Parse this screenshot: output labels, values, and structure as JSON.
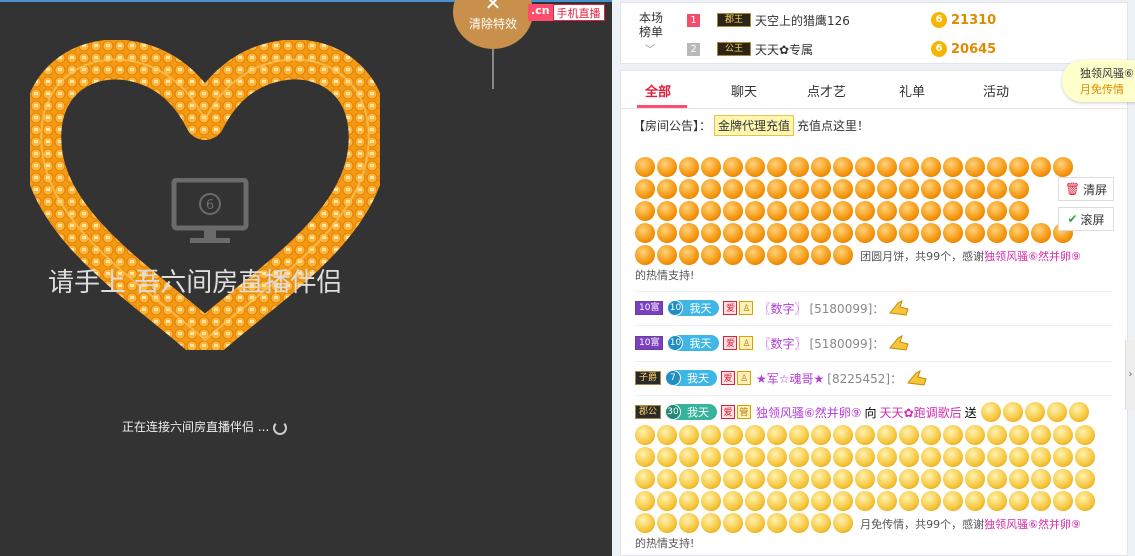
{
  "video": {
    "offline_text": "请手上  吾六间房直播伴侣",
    "loading_text": "正在连接六间房直播伴侣 ...",
    "clear_effects_label": "清除特效",
    "clear_icon": "close-icon",
    "mobile_badge_cn": ".cn",
    "mobile_badge_label": "手机直播",
    "monitor_icon": "monitor-icon",
    "monitor_glyph": "6"
  },
  "ranking": {
    "title": "本场\n榜单",
    "title_line1": "本场",
    "title_line2": "榜单",
    "chevron": "﹀",
    "rows": [
      {
        "rank": "1",
        "badge": "郡王",
        "name": "天空上的猎鹰126",
        "score": "21310",
        "color": "#f24d6a"
      },
      {
        "rank": "2",
        "badge": "公王",
        "name": "天天✿专属",
        "score": "20645",
        "color": "#b9b9b9"
      }
    ],
    "coin_glyph": "6"
  },
  "float": {
    "line1": "独领风骚⑥",
    "line2": "月免传情"
  },
  "tabs": {
    "items": [
      "全部",
      "聊天",
      "点才艺",
      "礼单",
      "活动"
    ],
    "active": "全部"
  },
  "notice": {
    "prefix": "【房间公告】：",
    "gold_label": "金牌代理充值",
    "suffix": "充值点这里！"
  },
  "gift1": {
    "caption_a": "团圆月饼，共99个，感谢",
    "caption_user": "独领风骚⑥然并卵⑨",
    "caption_b": "的热情支持!"
  },
  "side_buttons": {
    "clear_label": "清屏",
    "scroll_label": "滚屏"
  },
  "messages": [
    {
      "level": "10富",
      "fan_lv": "10",
      "fan_name": "我天",
      "s1": "爱",
      "s2": "♙",
      "user": "〖数字〗",
      "uid": "[5180099]："
    },
    {
      "level": "10富",
      "fan_lv": "10",
      "fan_name": "我天",
      "s1": "爱",
      "s2": "♙",
      "user": "〖数字〗",
      "uid": "[5180099]："
    },
    {
      "level": "子爵",
      "fan_lv": "7",
      "fan_name": "我天",
      "s1": "爱",
      "s2": "♙",
      "user": "★军☆魂哥★",
      "uid": "[8225452]："
    }
  ],
  "gift_msg": {
    "level": "郡公",
    "fan_lv": "30",
    "fan_name": "我天",
    "s1": "爱",
    "s2": "管",
    "user": "独领风骚⑥然并卵⑨",
    "to": "向",
    "target": "天天✿跑调歌后",
    "send": "送",
    "caption_a": "月免传情，共99个，感谢",
    "caption_user": "独领风骚⑥然并卵⑨",
    "caption_b": "的热情支持!"
  },
  "edge_tab": "›"
}
